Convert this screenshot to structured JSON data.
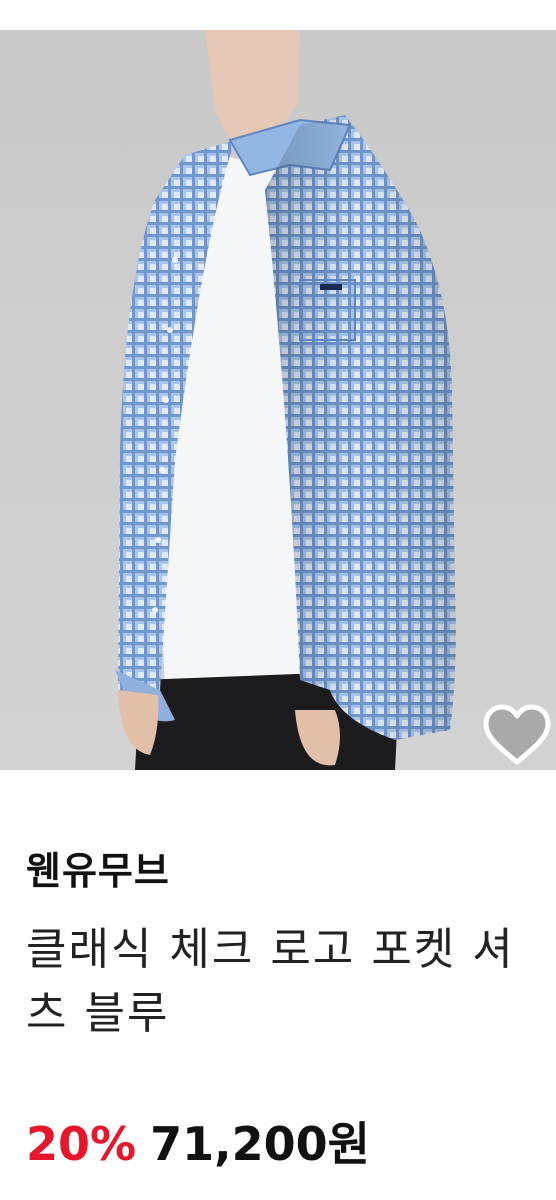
{
  "product": {
    "brand": "웬유무브",
    "title": "클래식 체크 로고 포켓 셔츠 블루",
    "discount": "20%",
    "price": "71,200원",
    "image_alt": "blue check shirt product photo",
    "wish_icon": "heart-outline-icon"
  },
  "colors": {
    "discount": "#e8162a",
    "text": "#111111",
    "image_background": "#cccccc",
    "shirt_blue": "#8fb3e0"
  }
}
